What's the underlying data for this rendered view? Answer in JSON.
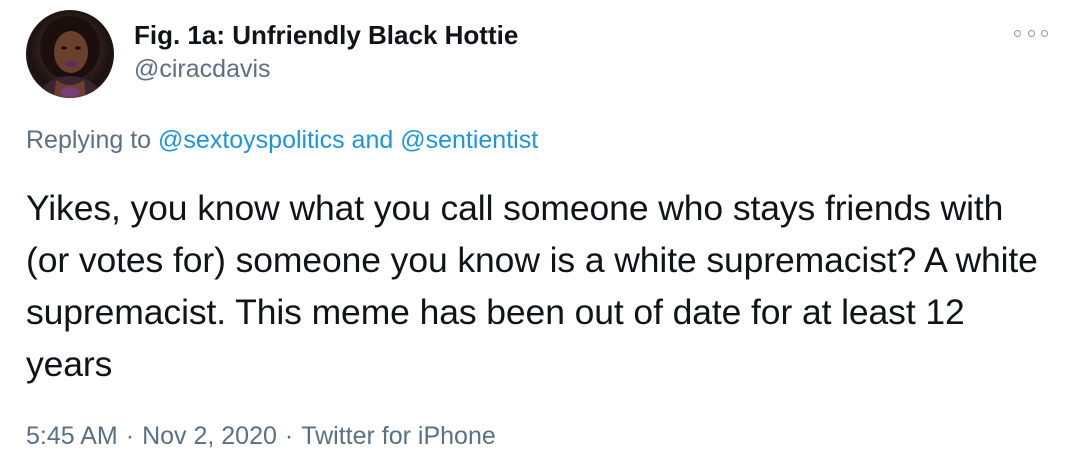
{
  "tweet": {
    "display_name": "Fig. 1a: Unfriendly Black Hottie",
    "handle": "@ciracdavis",
    "reply_prefix": "Replying to",
    "reply_mentions": [
      "@sextoyspolitics",
      "@sentientist"
    ],
    "reply_joiner": "and",
    "text": "Yikes, you know what you call someone who stays friends with (or votes for) someone you know is a white supremacist? A white supremacist. This meme has been out of date for at least 12 years",
    "time": "5:45 AM",
    "date": "Nov 2, 2020",
    "source": "Twitter for iPhone",
    "separator": "·"
  },
  "icons": {
    "more": "more-options-icon",
    "avatar": "avatar"
  },
  "colors": {
    "text": "#0f1419",
    "secondary": "#5b7083",
    "link": "#1b95e0",
    "background": "#ffffff"
  }
}
